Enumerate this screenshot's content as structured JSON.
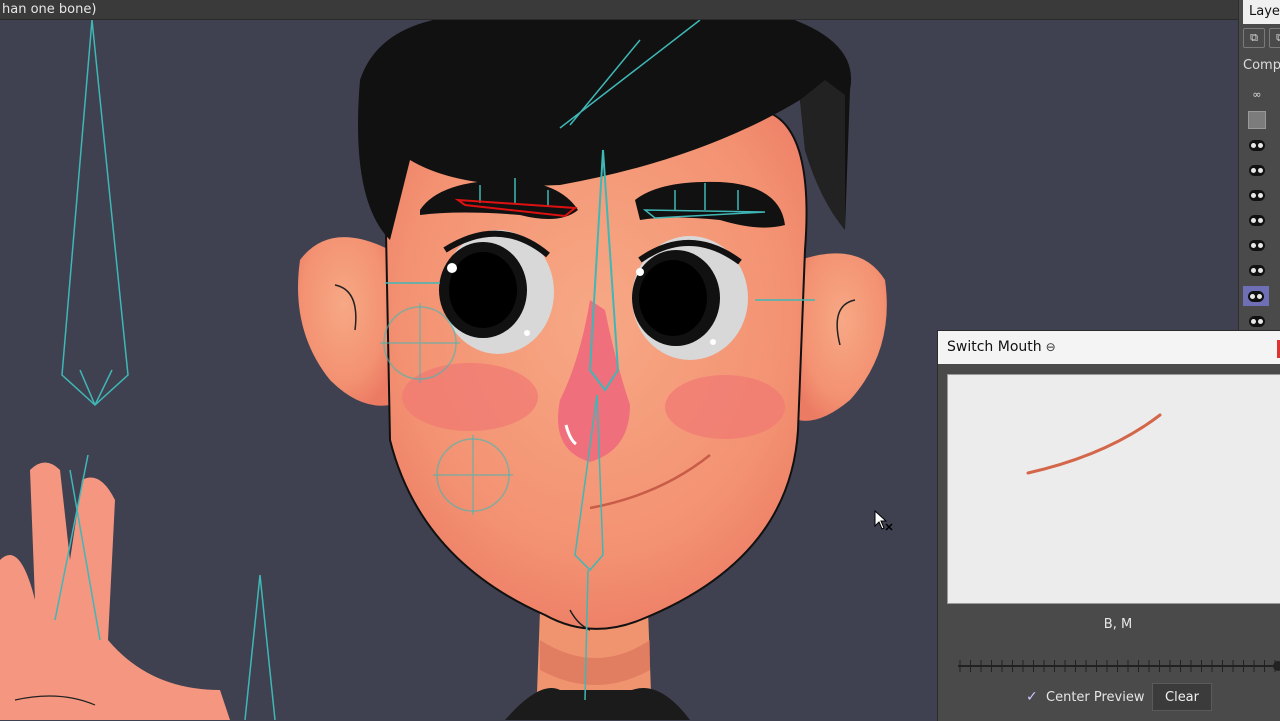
{
  "topbar": {
    "text": "han one bone)"
  },
  "layers_panel": {
    "tab_label": "Layer",
    "comp_label": "Comp",
    "rows": [
      "link-icon",
      "swatch",
      "eye",
      "eye",
      "eye",
      "eye",
      "eye",
      "eye",
      "eye-selected",
      "eye"
    ]
  },
  "switch_panel": {
    "title": "Switch Mouth",
    "frame_label": "B, M",
    "center_preview_label": "Center Preview",
    "center_preview_checked": true,
    "clear_label": "Clear"
  },
  "colors": {
    "background": "#3f4150",
    "skin": "#f39a78",
    "bone": "#3fb7b6",
    "hair": "#111111",
    "selected_row": "#6f6fb6",
    "mouth_stroke": "#d4664a"
  }
}
